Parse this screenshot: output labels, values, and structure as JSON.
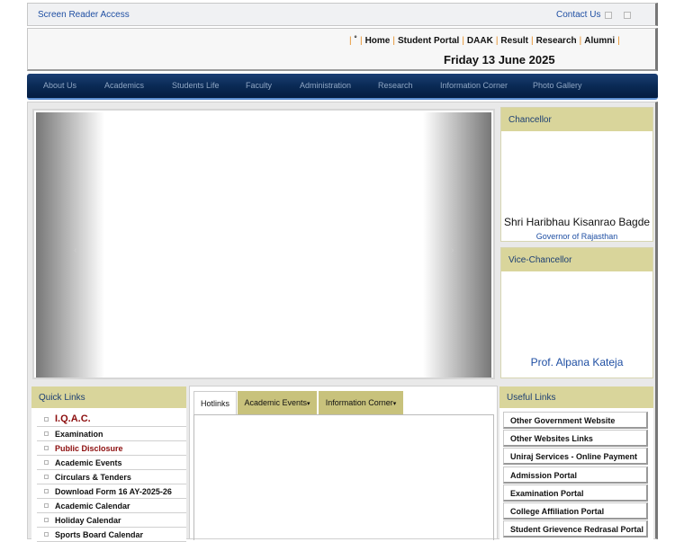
{
  "topbar": {
    "screen_reader": "Screen Reader Access",
    "contact": "Contact Us"
  },
  "header": {
    "top_links": [
      {
        "label": "˚"
      },
      {
        "label": "Home"
      },
      {
        "label": "Student Portal"
      },
      {
        "label": "DAAK"
      },
      {
        "label": "Result"
      },
      {
        "label": "Research"
      },
      {
        "label": "Alumni"
      }
    ],
    "date": "Friday 13 June 2025"
  },
  "nav": {
    "items": [
      "About Us",
      "Academics",
      "Students Life",
      "Faculty",
      "Administration",
      "Research",
      "Information Corner",
      "Photo Gallery"
    ]
  },
  "slider": {
    "prev": "‹",
    "next": "›"
  },
  "chancellor": {
    "title": "Chancellor",
    "name": "Shri Haribhau Kisanrao Bagde",
    "designation": "Governor of Rajasthan"
  },
  "vice_chancellor": {
    "title": "Vice-Chancellor",
    "name": "Prof. Alpana Kateja"
  },
  "quick_links": {
    "title": "Quick Links",
    "items": [
      "I.Q.A.C.",
      "Examination",
      "Public Disclosure",
      "Academic Events",
      "Circulars & Tenders",
      "Download Form 16 AY-2025-26",
      "Academic Calendar",
      "Holiday Calendar",
      "Sports Board Calendar"
    ]
  },
  "tabs": {
    "hotlinks": "Hotlinks",
    "academic_events": "Academic Events",
    "information_corner": "Information Corner",
    "caret": "▾"
  },
  "useful_links": {
    "title": "Useful Links",
    "items": [
      "Other Government Website",
      "Other Websites Links",
      "Uniraj Services - Online Payment",
      "Admission Portal",
      "Examination Portal",
      "College Affiliation Portal",
      "Student Grievence Redrasal Portal"
    ]
  }
}
